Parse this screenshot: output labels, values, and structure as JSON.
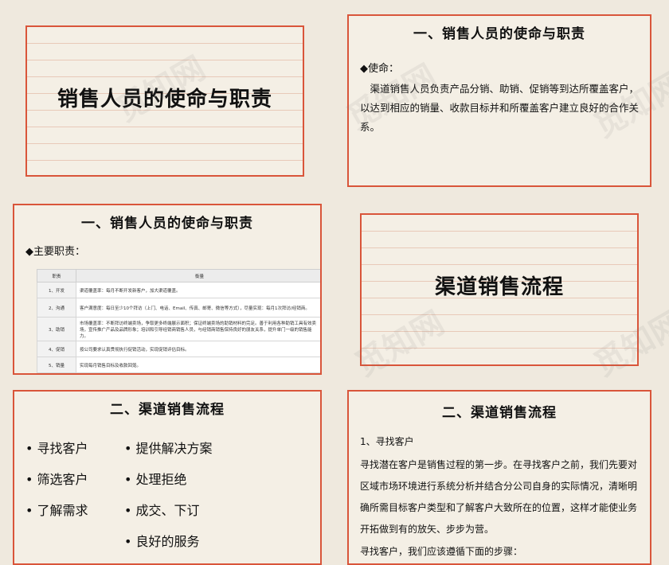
{
  "slide1": {
    "title": "销售人员的使命与职责"
  },
  "slide2": {
    "title": "一、销售人员的使命与职责",
    "mission_head": "◆使命：",
    "mission_text": "渠道销售人员负责产品分销、助销、促销等到达所覆盖客户，以达到相应的销量、收款目标并和所覆盖客户建立良好的合作关系。"
  },
  "slide3": {
    "title": "一、销售人员的使命与职责",
    "duties_head": "◆主要职责：",
    "table": {
      "headers": [
        "职责",
        "衡量"
      ],
      "rows": [
        [
          "1、开发",
          "渠道覆盖率：每月不断开发新客户，加大渠道覆盖。"
        ],
        [
          "2、沟通",
          "客户满意度：每日至少10个拜访（上门、电话、Email、传真、邮寄、微信等方式），尽量实现：每月1次拜访/经销商。"
        ],
        [
          "3、助销",
          "市场覆盖率：不断拜访终端卖场，争取更多终端展示面积；保证终端卖场的助销材料的完足。善于利用各种助销工具有效卖场，宣传推广产品及品牌形象；培训和引导经销商销售人员，与经销商销售保持良好的朋友关系，提升单门一级的销售能力。"
        ],
        [
          "4、促销",
          "按公司要求认真贯彻执行促销活动，实现促销评估目标。"
        ],
        [
          "5、销量",
          "实现每月销售目标及收款回笼。"
        ]
      ]
    }
  },
  "slide4": {
    "title": "渠道销售流程"
  },
  "slide5": {
    "title": "二、渠道销售流程",
    "left_items": [
      "寻找客户",
      "筛选客户",
      "了解需求"
    ],
    "right_items": [
      "提供解决方案",
      "处理拒绝",
      "成交、下订",
      "良好的服务"
    ]
  },
  "slide6": {
    "title": "二、渠道销售流程",
    "step": "1、寻找客户",
    "text": "寻找潜在客户是销售过程的第一步。在寻找客户之前，我们先要对区域市场环境进行系统分析并结合分公司自身的实际情况，清晰明确所需目标客户类型和了解客户大致所在的位置，这样才能使业务开拓做到有的放矢、步步为营。",
    "tail": "寻找客户，我们应该遵循下面的步骤："
  },
  "watermark": "觅知网"
}
